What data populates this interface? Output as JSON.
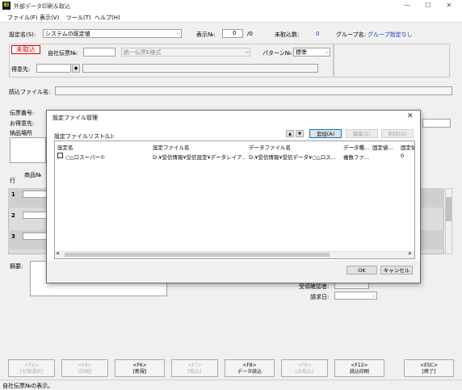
{
  "window": {
    "title": "外部データ印刷＆取込",
    "icon_text": "EI",
    "minimize_glyph": "—",
    "maximize_glyph": "☐",
    "close_glyph": "✕"
  },
  "menu": [
    "ファイル(F)",
    "表示(V)",
    "ツール(T)",
    "ヘルプ(H)"
  ],
  "settings": {
    "label": "設定名(S):",
    "value": "システムの既定値",
    "display_no_label": "表示№:",
    "display_no_value": "0",
    "display_no_total": "/0",
    "unimported_label": "未取込数:",
    "unimported_value": "0",
    "group_label": "グループ名:",
    "group_value": "グループ指定なし"
  },
  "header": {
    "status_badge": "未取込",
    "slip_no_label": "自社伝票№:",
    "slip_type_value": "統一伝票E様式",
    "pattern_label": "パターン№:",
    "pattern_value": "標準",
    "customer_label": "得意先:",
    "customer_btn": "◆"
  },
  "read_file_label": "読込ファイル名:",
  "form": {
    "slip_number_label": "伝票番号:",
    "customer_label": "お得意先:",
    "delivery_label": "納品場所",
    "row_label": "行",
    "product_label": "商品№",
    "rows": [
      "1",
      "2",
      "3"
    ],
    "remarks_label": "摘要:",
    "receiver_label": "受領確認者:",
    "billing_date_label": "請求日:"
  },
  "dialog": {
    "title": "設定ファイル管理",
    "close_glyph": "✕",
    "list_label": "設定ファイルリスト(L):",
    "up_glyph": "▲",
    "down_glyph": "▼",
    "add_button": "追加(A)",
    "edit_button": "編集(E)",
    "delete_button": "削除(D)",
    "columns": [
      "設定名",
      "設定ファイル名",
      "データファイル名",
      "データ種...",
      "固定値...",
      "固定値"
    ],
    "rows": [
      {
        "name": "○△ロスーパー①",
        "settings_file": "D:¥受信情報¥受信設定¥データレイア...",
        "data_file": "D:¥受信情報¥受信データ¥○△ロス...",
        "data_type": "複数ファ...",
        "fixed1": "",
        "fixed2": "0"
      }
    ],
    "scroll_left_glyph": "◀",
    "scroll_right_glyph": "▶",
    "ok_button": "OK",
    "cancel_button": "キャンセル"
  },
  "fkeys": [
    {
      "key": "<F2>",
      "label": "[分類選択]",
      "enabled": false
    },
    {
      "key": "<F4>",
      "label": "[印刷]",
      "enabled": false
    },
    {
      "key": "<F6>",
      "label": "[新規]",
      "enabled": true
    },
    {
      "key": "<F7>",
      "label": "[取込]",
      "enabled": false
    },
    {
      "key": "<F8>",
      "label": "データ読込",
      "enabled": true
    },
    {
      "key": "<F9>",
      "label": "[未取込]",
      "enabled": false
    },
    {
      "key": "<F12>",
      "label": "読込印刷",
      "enabled": true
    },
    {
      "key": "<ESC>",
      "label": "[終了]",
      "enabled": true
    }
  ],
  "status_bar": "自社伝票№の表示。"
}
